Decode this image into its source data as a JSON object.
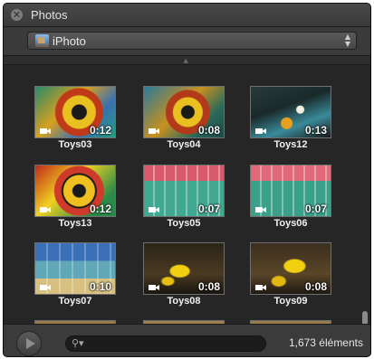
{
  "window": {
    "title": "Photos"
  },
  "source": {
    "selected": "iPhoto"
  },
  "items": [
    {
      "name": "Toys03",
      "duration": "0:12"
    },
    {
      "name": "Toys04",
      "duration": "0:08"
    },
    {
      "name": "Toys12",
      "duration": "0:13"
    },
    {
      "name": "Toys13",
      "duration": "0:12"
    },
    {
      "name": "Toys05",
      "duration": "0:07"
    },
    {
      "name": "Toys06",
      "duration": "0:07"
    },
    {
      "name": "Toys07",
      "duration": "0:10"
    },
    {
      "name": "Toys08",
      "duration": "0:08"
    },
    {
      "name": "Toys09",
      "duration": "0:08"
    }
  ],
  "footer": {
    "count": "1,673 éléments",
    "search_placeholder": ""
  },
  "colors": {
    "background": "#262626",
    "bar": "#3b3b3b"
  }
}
